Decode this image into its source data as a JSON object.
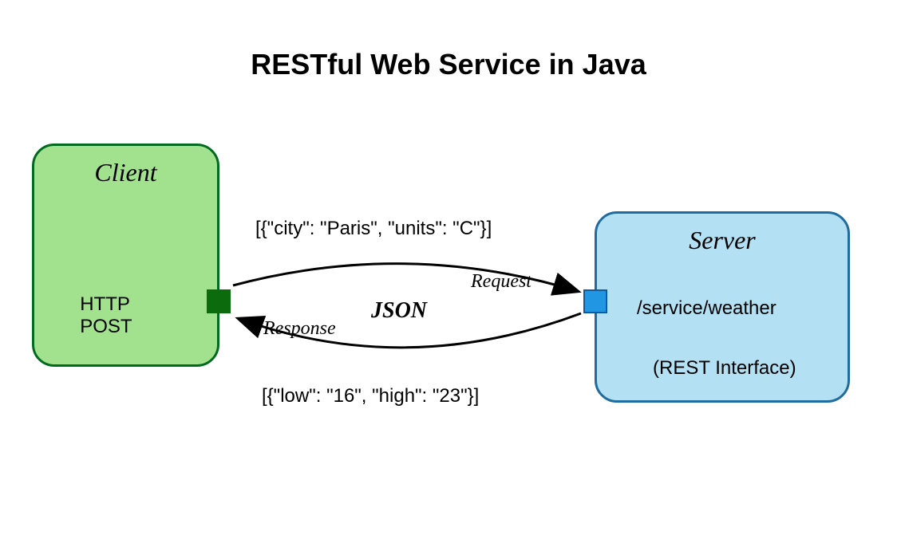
{
  "title": "RESTful Web Service in Java",
  "client": {
    "title": "Client",
    "method": "HTTP POST"
  },
  "server": {
    "title": "Server",
    "endpoint": "/service/weather",
    "interface": "(REST Interface)"
  },
  "exchange": {
    "format": "JSON",
    "request_label": "Request",
    "response_label": "Response",
    "request_payload": "[{\"city\": \"Paris\", \"units\": \"C\"}]",
    "response_payload": "[{\"low\": \"16\", \"high\": \"23\"}]"
  }
}
